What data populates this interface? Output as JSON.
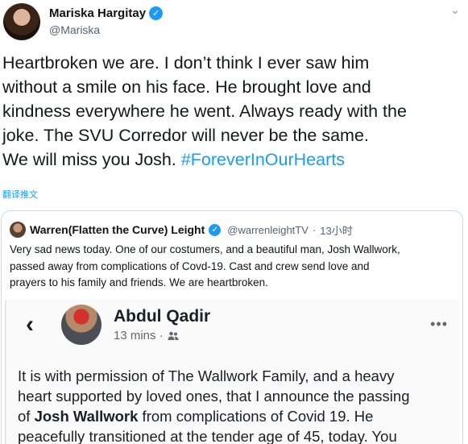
{
  "tweet": {
    "author_name": "Mariska Hargitay",
    "author_handle": "@Mariska",
    "text_lines": [
      "Heartbroken we are.  I don’t think I ever saw him",
      "without a smile on his face. He brought love and",
      "kindness everywhere he went. Always ready with the",
      "joke. The SVU Corredor will never be the same.",
      "We will miss you Josh. "
    ],
    "hashtag": "#ForeverInOurHearts",
    "translate_label": "翻译推文"
  },
  "quoted_tweet": {
    "author_name": "Warren(Flatten the Curve) Leight",
    "author_handle": "@warrenleightTV",
    "separator": "·",
    "time": "13小时",
    "text_lines": [
      "Very sad news today.  One of our costumers, and a beautiful man, Josh Wallwork,",
      "passed away  from complications of Covd-19.  Cast and crew send love and",
      "prayers to his family and friends.  We are heartbroken."
    ]
  },
  "facebook_post": {
    "back_icon": "‹",
    "author_name": "Abdul Qadir",
    "time": "13 mins ·",
    "audience_icon": "friends-icon",
    "more_icon": "•••",
    "line1": "It is with permission of The Wallwork Family, and a heavy",
    "line2": "heart supported by loved ones, that I announce the passing",
    "line3_prefix": "of ",
    "line3_bold": "Josh Wallwork",
    "line3_suffix": " from complications of Covid 19. He",
    "line4": "peacefully transitioned at the tender age of 45, today. You"
  },
  "colors": {
    "link": "#1d9bf0",
    "verified": "#1d9bf0"
  }
}
